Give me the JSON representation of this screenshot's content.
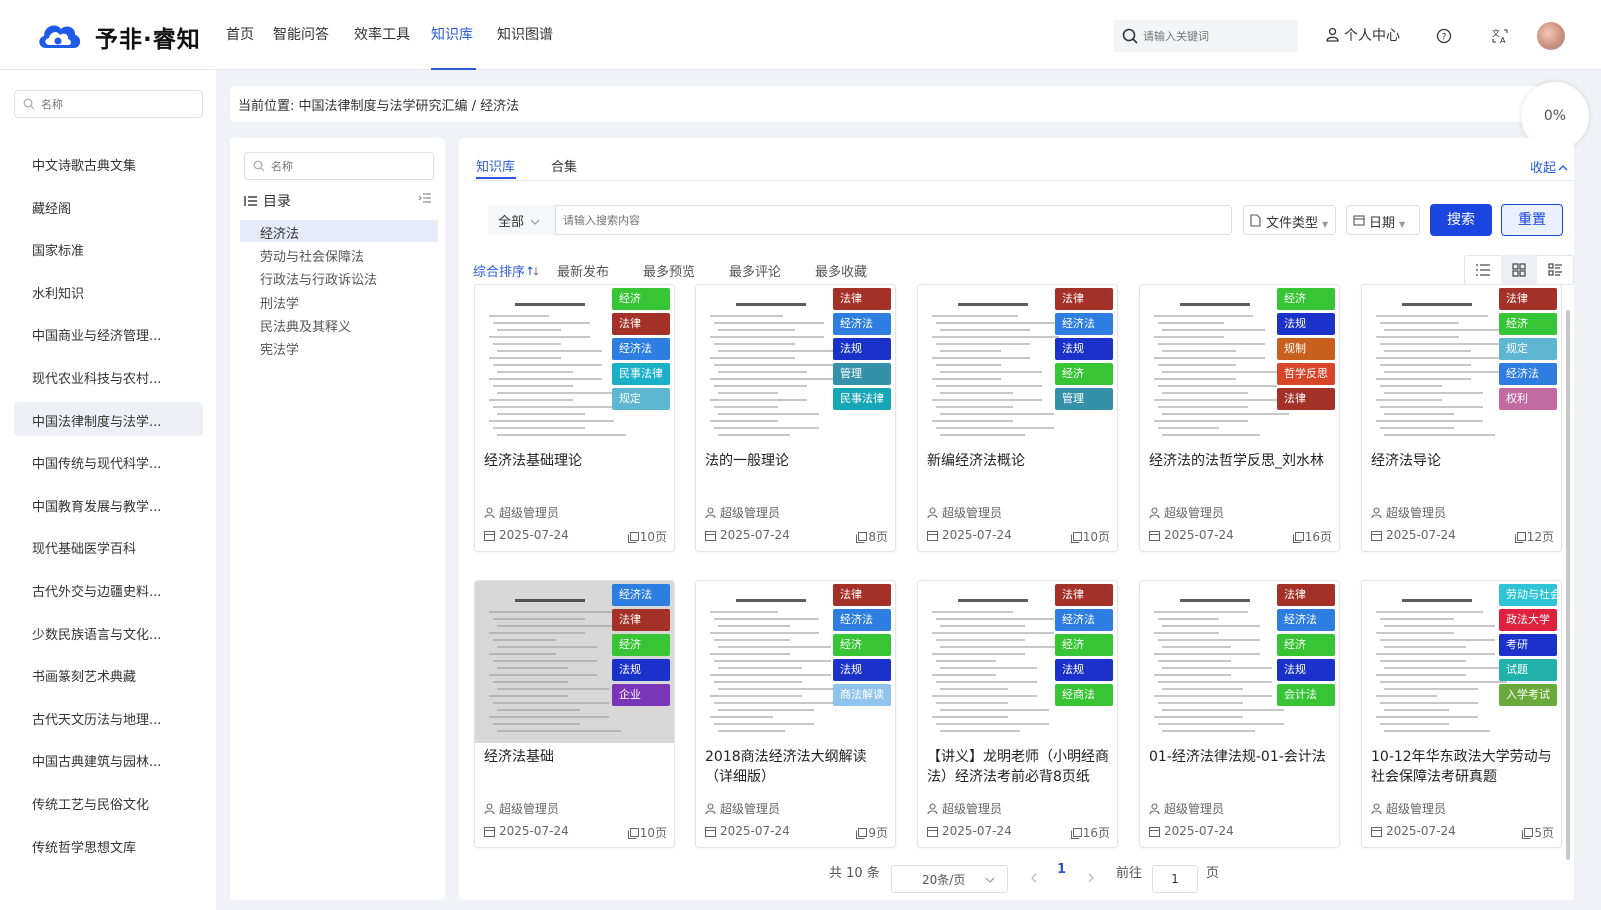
{
  "header": {
    "brand": "予非·睿知",
    "nav": [
      "首页",
      "智能问答",
      "效率工具",
      "知识库",
      "知识图谱"
    ],
    "nav_active": "知识库",
    "search_placeholder": "请输入关键词",
    "personal_center": "个人中心",
    "icons": [
      "help-icon",
      "translate-icon",
      "user-avatar"
    ]
  },
  "sidebar": {
    "search_placeholder": "名称",
    "items": [
      "中文诗歌古典文集",
      "藏经阁",
      "国家标准",
      "水利知识",
      "中国商业与经济管理...",
      "现代农业科技与农村...",
      "中国法律制度与法学...",
      "中国传统与现代科学...",
      "中国教育发展与教学...",
      "现代基础医学百科",
      "古代外交与边疆史料...",
      "少数民族语言与文化...",
      "书画篆刻艺术典藏",
      "古代天文历法与地理...",
      "中国古典建筑与园林...",
      "传统工艺与民俗文化",
      "传统哲学思想文库"
    ],
    "active_index": 6
  },
  "breadcrumb": "当前位置: 中国法律制度与法学研究汇编 / 经济法",
  "progress": "0%",
  "tree": {
    "search_placeholder": "名称",
    "title": "目录",
    "items": [
      "经济法",
      "劳动与社会保障法",
      "行政法与行政诉讼法",
      "刑法学",
      "民法典及其释义",
      "宪法学"
    ],
    "active_index": 0
  },
  "main": {
    "tabs": [
      "知识库",
      "合集"
    ],
    "active_tab": "知识库",
    "collapse": "收起",
    "filter": {
      "scope": "全部",
      "placeholder": "请输入搜索内容",
      "file_type": "文件类型",
      "date": "日期",
      "search_btn": "搜索",
      "reset_btn": "重置"
    },
    "sorts": [
      "综合排序",
      "最新发布",
      "最多预览",
      "最多评论",
      "最多收藏"
    ],
    "active_sort": "综合排序",
    "view_modes": [
      "list-view-icon",
      "grid-view-icon",
      "detail-view-icon"
    ],
    "active_view": "grid-view-icon"
  },
  "cards": [
    {
      "title": "经济法基础理论",
      "user": "超级管理员",
      "date": "2025-07-24",
      "pages": "10页",
      "tags": [
        {
          "t": "经济",
          "c": "#37c536"
        },
        {
          "t": "法律",
          "c": "#a33127"
        },
        {
          "t": "经济法",
          "c": "#2e7de1"
        },
        {
          "t": "民事法律",
          "c": "#1bb0c8"
        },
        {
          "t": "规定",
          "c": "#5fb6d0"
        }
      ]
    },
    {
      "title": "法的一般理论",
      "user": "超级管理员",
      "date": "2025-07-24",
      "pages": "8页",
      "tags": [
        {
          "t": "法律",
          "c": "#a33127"
        },
        {
          "t": "经济法",
          "c": "#2e7de1"
        },
        {
          "t": "法规",
          "c": "#1a32c9"
        },
        {
          "t": "管理",
          "c": "#3591a9"
        },
        {
          "t": "民事法律",
          "c": "#16a6b6"
        }
      ]
    },
    {
      "title": "新编经济法概论",
      "user": "超级管理员",
      "date": "2025-07-24",
      "pages": "10页",
      "tags": [
        {
          "t": "法律",
          "c": "#a33127"
        },
        {
          "t": "经济法",
          "c": "#2e7de1"
        },
        {
          "t": "法规",
          "c": "#1a32c9"
        },
        {
          "t": "经济",
          "c": "#37c536"
        },
        {
          "t": "管理",
          "c": "#3591a9"
        }
      ]
    },
    {
      "title": "经济法的法哲学反思_刘水林",
      "user": "超级管理员",
      "date": "2025-07-24",
      "pages": "16页",
      "tags": [
        {
          "t": "经济",
          "c": "#37c536"
        },
        {
          "t": "法规",
          "c": "#1a32c9"
        },
        {
          "t": "规制",
          "c": "#c9601e"
        },
        {
          "t": "哲学反思",
          "c": "#d8462a"
        },
        {
          "t": "法律",
          "c": "#a33127"
        }
      ]
    },
    {
      "title": "经济法导论",
      "user": "超级管理员",
      "date": "2025-07-24",
      "pages": "12页",
      "tags": [
        {
          "t": "法律",
          "c": "#a33127"
        },
        {
          "t": "经济",
          "c": "#37c536"
        },
        {
          "t": "规定",
          "c": "#5fb6d0"
        },
        {
          "t": "经济法",
          "c": "#2e7de1"
        },
        {
          "t": "权利",
          "c": "#c46aa3"
        }
      ]
    },
    {
      "title": "经济法基础",
      "user": "超级管理员",
      "date": "2025-07-24",
      "pages": "10页",
      "tags": [
        {
          "t": "经济法",
          "c": "#2e7de1"
        },
        {
          "t": "法律",
          "c": "#a33127"
        },
        {
          "t": "经济",
          "c": "#37c536"
        },
        {
          "t": "法规",
          "c": "#1a32c9"
        },
        {
          "t": "企业",
          "c": "#7a35b8"
        }
      ]
    },
    {
      "title": "2018商法经济法大纲解读（详细版）",
      "user": "超级管理员",
      "date": "2025-07-24",
      "pages": "9页",
      "tags": [
        {
          "t": "法律",
          "c": "#a33127"
        },
        {
          "t": "经济法",
          "c": "#2e7de1"
        },
        {
          "t": "经济",
          "c": "#37c536"
        },
        {
          "t": "法规",
          "c": "#1a32c9"
        },
        {
          "t": "商法解读",
          "c": "#8fc4ee"
        }
      ]
    },
    {
      "title": "【讲义】龙明老师（小明经商法）经济法考前必背8页纸",
      "user": "超级管理员",
      "date": "2025-07-24",
      "pages": "16页",
      "tags": [
        {
          "t": "法律",
          "c": "#a33127"
        },
        {
          "t": "经济法",
          "c": "#2e7de1"
        },
        {
          "t": "经济",
          "c": "#37c536"
        },
        {
          "t": "法规",
          "c": "#1a32c9"
        },
        {
          "t": "经商法",
          "c": "#37c536"
        }
      ]
    },
    {
      "title": "01-经济法律法规-01-会计法",
      "user": "超级管理员",
      "date": "2025-07-24",
      "pages": "",
      "tags": [
        {
          "t": "法律",
          "c": "#a33127"
        },
        {
          "t": "经济法",
          "c": "#2e7de1"
        },
        {
          "t": "经济",
          "c": "#37c536"
        },
        {
          "t": "法规",
          "c": "#1a32c9"
        },
        {
          "t": "会计法",
          "c": "#37c536"
        }
      ]
    },
    {
      "title": "10-12年华东政法大学劳动与社会保障法考研真题",
      "user": "超级管理员",
      "date": "2025-07-24",
      "pages": "5页",
      "tags": [
        {
          "t": "劳动与社会保障",
          "c": "#2fc3d6"
        },
        {
          "t": "政法大学",
          "c": "#e0213d"
        },
        {
          "t": "考研",
          "c": "#1a32c9"
        },
        {
          "t": "试题",
          "c": "#20b2aa"
        },
        {
          "t": "入学考试",
          "c": "#6aaa3a"
        }
      ]
    }
  ],
  "pagination": {
    "total": "共 10 条",
    "page_size": "20条/页",
    "current": "1",
    "goto_label": "前往",
    "goto_value": "1",
    "page_suffix": "页"
  }
}
